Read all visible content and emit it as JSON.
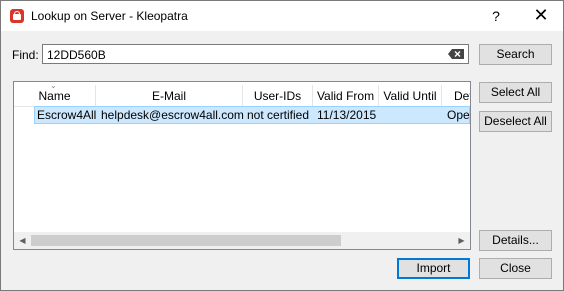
{
  "window": {
    "title": "Lookup on Server - Kleopatra",
    "help_label": "?",
    "close_label": "✕"
  },
  "find": {
    "label": "Find:",
    "value": "12DD560B"
  },
  "buttons": {
    "search": "Search",
    "select_all": "Select All",
    "deselect_all": "Deselect All",
    "details": "Details...",
    "import": "Import",
    "close": "Close"
  },
  "table": {
    "columns": [
      "Name",
      "E-Mail",
      "User-IDs",
      "Valid From",
      "Valid Until",
      "Det"
    ],
    "rows": [
      {
        "name": "Escrow4All",
        "email": "helpdesk@escrow4all.com",
        "user_ids": "not certified",
        "valid_from": "11/13/2015",
        "valid_until": "",
        "details": "Oper"
      }
    ]
  }
}
